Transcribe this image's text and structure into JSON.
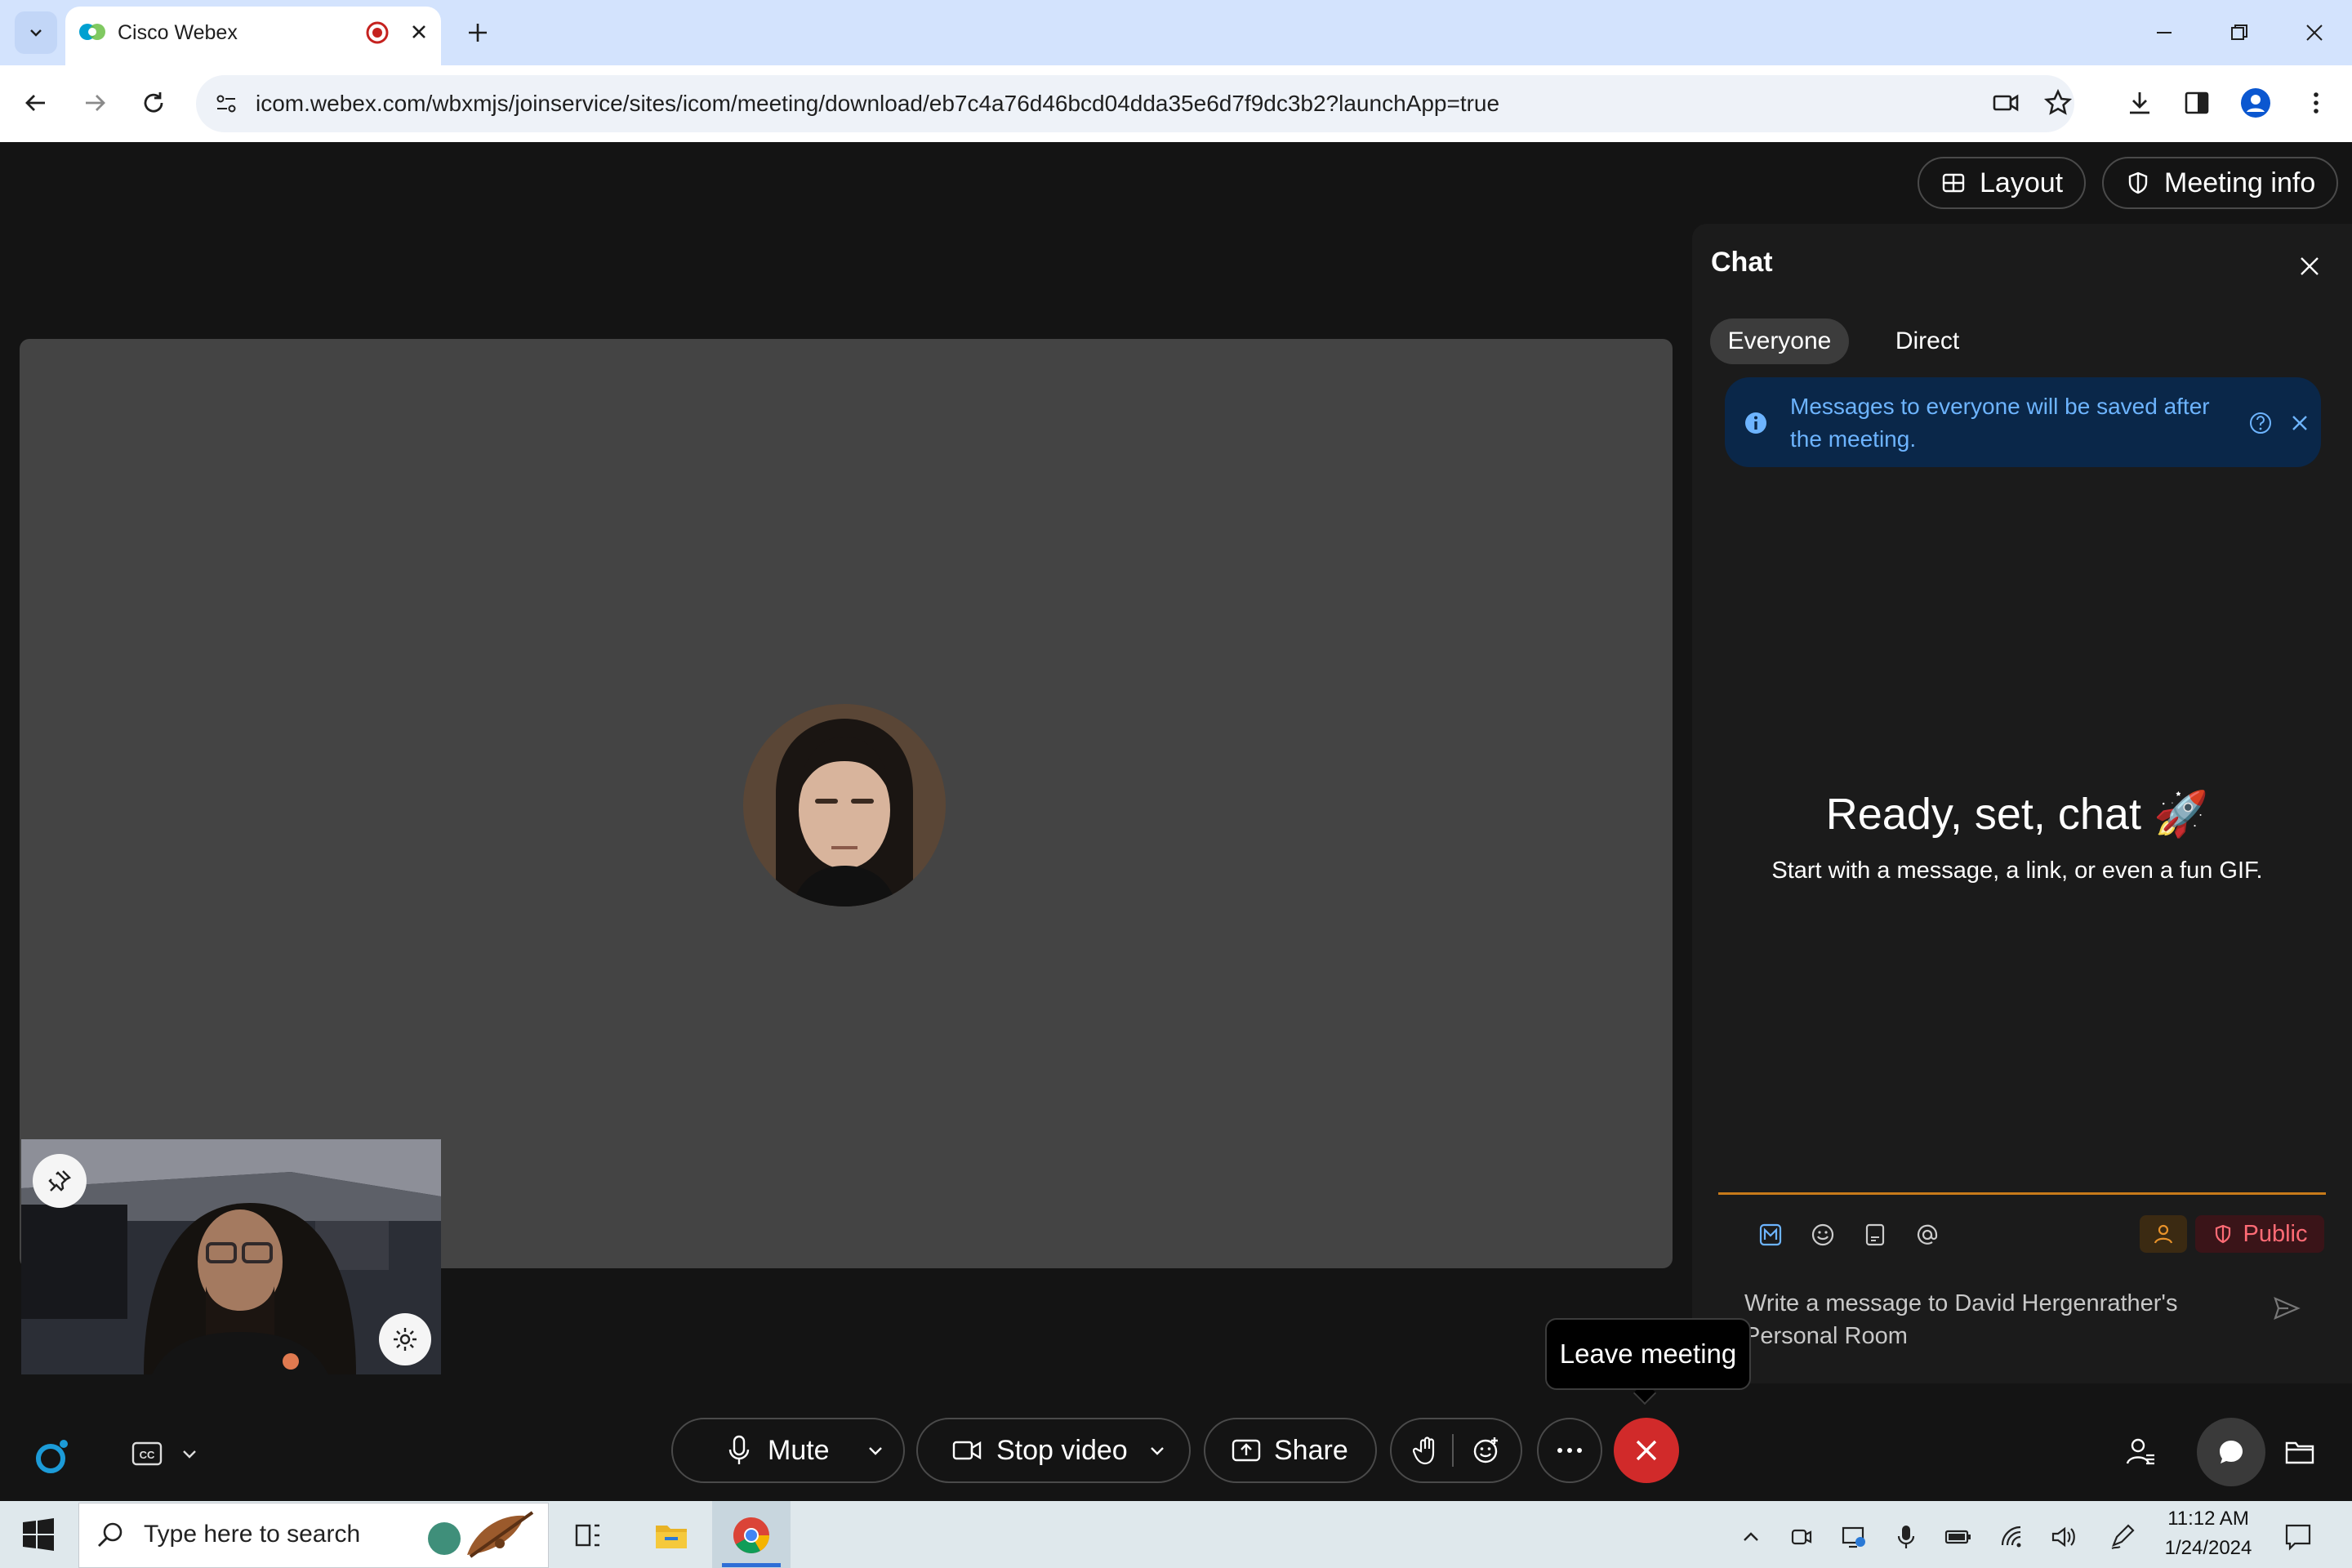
{
  "browser": {
    "tab_title": "Cisco Webex",
    "url": "icom.webex.com/wbxmjs/joinservice/sites/icom/meeting/download/eb7c4a76d46bcd04dda35e6d7f9dc3b2?launchApp=true"
  },
  "header": {
    "layout_label": "Layout",
    "meeting_info_label": "Meeting info"
  },
  "chat": {
    "title": "Chat",
    "tabs": [
      "Everyone",
      "Direct"
    ],
    "notice": "Messages to everyone will be saved after the meeting.",
    "empty_title": "Ready, set, chat 🚀",
    "empty_subtitle": "Start with a message, a link, or even a fun GIF.",
    "visibility_label": "Public",
    "placeholder": "Write a message to David Hergenrather's Personal Room"
  },
  "tooltip": "Leave meeting",
  "controls": {
    "mute_label": "Mute",
    "stop_video_label": "Stop video",
    "share_label": "Share"
  },
  "taskbar": {
    "search_placeholder": "Type here to search",
    "time": "11:12 AM",
    "date": "1/24/2024"
  },
  "colors": {
    "leave_red": "#d12a2a",
    "notice_bg": "#0a2749",
    "notice_text": "#6db4ff",
    "public_red": "#ff6b75",
    "accent_orange": "#c77a1a"
  }
}
